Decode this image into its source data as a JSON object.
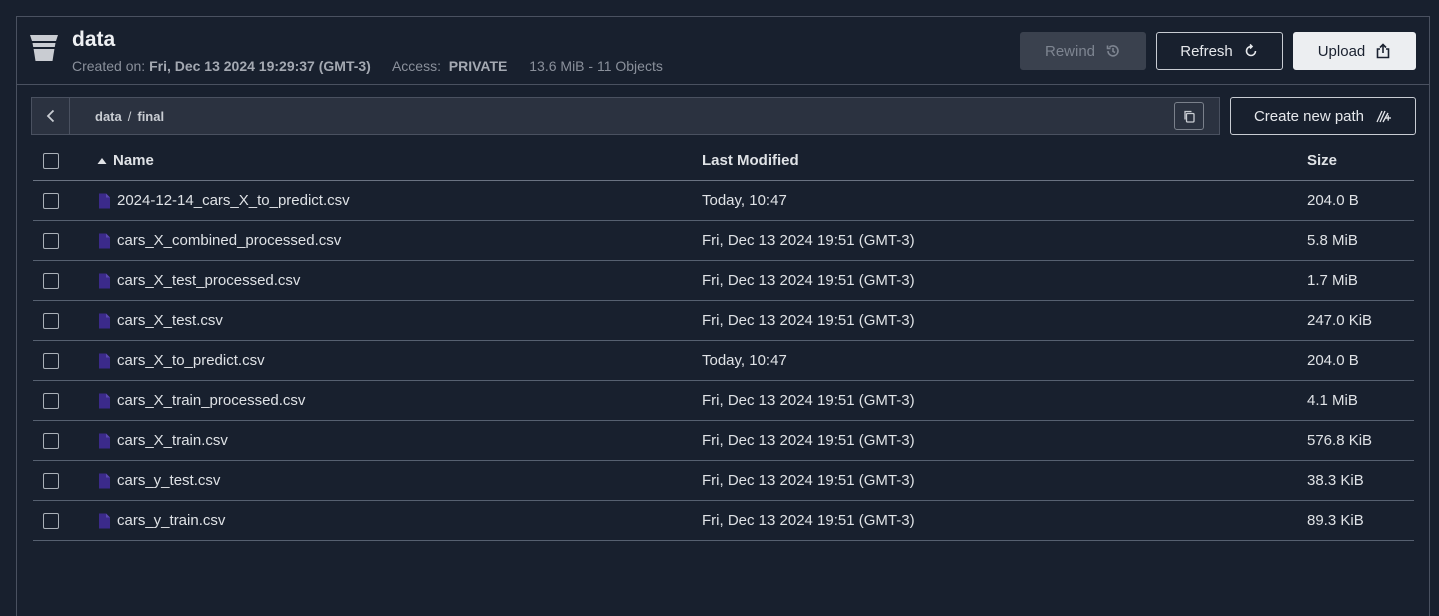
{
  "bucket": {
    "title": "data",
    "created_label": "Created on:",
    "created_value": "Fri, Dec 13 2024 19:29:37 (GMT-3)",
    "access_label": "Access:",
    "access_value": "PRIVATE",
    "usage": "13.6 MiB - 11 Objects"
  },
  "toolbar": {
    "rewind_label": "Rewind",
    "refresh_label": "Refresh",
    "upload_label": "Upload",
    "new_path_label": "Create new path"
  },
  "path": {
    "root": "data",
    "separator": "/",
    "current": "final"
  },
  "table": {
    "columns": {
      "name": "Name",
      "modified": "Last Modified",
      "size": "Size"
    },
    "rows": [
      {
        "name": "2024-12-14_cars_X_to_predict.csv",
        "modified": "Today, 10:47",
        "size": "204.0 B"
      },
      {
        "name": "cars_X_combined_processed.csv",
        "modified": "Fri, Dec 13 2024 19:51 (GMT-3)",
        "size": "5.8 MiB"
      },
      {
        "name": "cars_X_test_processed.csv",
        "modified": "Fri, Dec 13 2024 19:51 (GMT-3)",
        "size": "1.7 MiB"
      },
      {
        "name": "cars_X_test.csv",
        "modified": "Fri, Dec 13 2024 19:51 (GMT-3)",
        "size": "247.0 KiB"
      },
      {
        "name": "cars_X_to_predict.csv",
        "modified": "Today, 10:47",
        "size": "204.0 B"
      },
      {
        "name": "cars_X_train_processed.csv",
        "modified": "Fri, Dec 13 2024 19:51 (GMT-3)",
        "size": "4.1 MiB"
      },
      {
        "name": "cars_X_train.csv",
        "modified": "Fri, Dec 13 2024 19:51 (GMT-3)",
        "size": "576.8 KiB"
      },
      {
        "name": "cars_y_test.csv",
        "modified": "Fri, Dec 13 2024 19:51 (GMT-3)",
        "size": "38.3 KiB"
      },
      {
        "name": "cars_y_train.csv",
        "modified": "Fri, Dec 13 2024 19:51 (GMT-3)",
        "size": "89.3 KiB"
      }
    ]
  },
  "colors": {
    "background": "#18202e",
    "file_icon": "#3b2a8a",
    "upload_button": "#eceef1"
  },
  "icons": {
    "bucket": "bucket-icon",
    "rewind": "history-icon",
    "refresh": "refresh-icon",
    "upload": "upload-icon",
    "back": "chevron-left-icon",
    "copy": "copy-icon",
    "new_path": "new-path-icon",
    "file": "file-icon",
    "sort": "sort-asc-icon"
  }
}
